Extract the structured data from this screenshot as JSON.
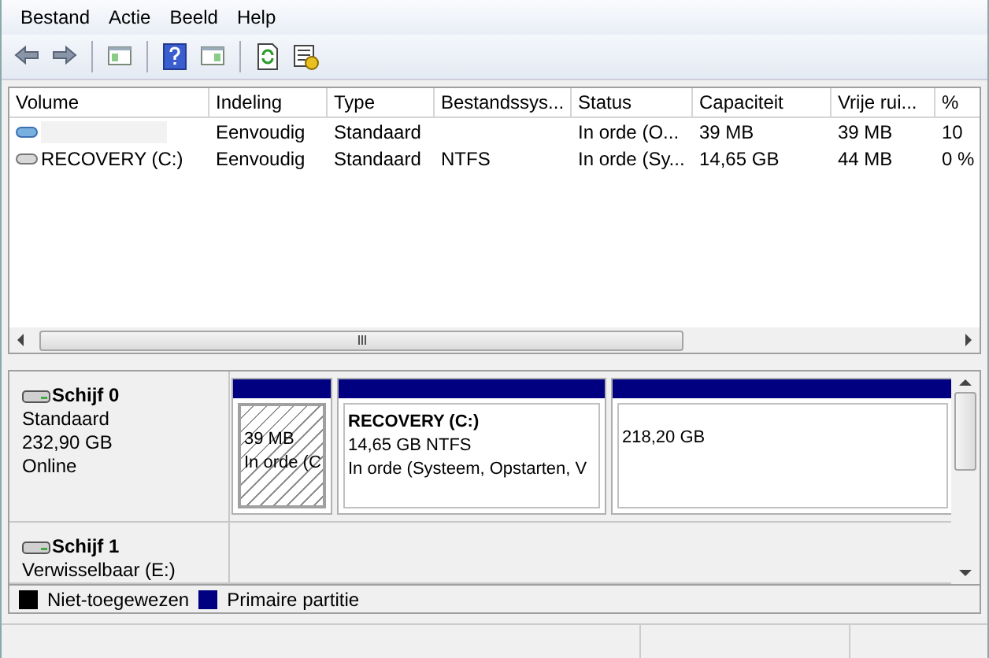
{
  "menu": [
    "Bestand",
    "Actie",
    "Beeld",
    "Help"
  ],
  "toolbar": [
    {
      "kind": "back",
      "disabled": false
    },
    {
      "kind": "forward",
      "disabled": false
    },
    {
      "kind": "sep"
    },
    {
      "kind": "pane",
      "disabled": false
    },
    {
      "kind": "sep"
    },
    {
      "kind": "help",
      "disabled": false
    },
    {
      "kind": "pane2",
      "disabled": false
    },
    {
      "kind": "sep"
    },
    {
      "kind": "refresh",
      "disabled": false
    },
    {
      "kind": "properties",
      "disabled": false
    }
  ],
  "volumes": {
    "columns": [
      "Volume",
      "Indeling",
      "Type",
      "Bestandssys...",
      "Status",
      "Capaciteit",
      "Vrije rui...",
      "%"
    ],
    "rows": [
      {
        "kind": "blue",
        "cells": [
          null,
          "Eenvoudig",
          "Standaard",
          null,
          "In orde (O...",
          "39 MB",
          "39 MB",
          "10"
        ]
      },
      {
        "kind": "grey",
        "cells": [
          "RECOVERY (C:)",
          "Eenvoudig",
          "Standaard",
          "NTFS",
          "In orde (Sy...",
          "14,65 GB",
          "44 MB",
          "0 %"
        ]
      }
    ]
  },
  "disks": [
    {
      "name": "Schijf 0",
      "lines": [
        "Standaard",
        "232,90 GB",
        "Online"
      ],
      "partitions": [
        {
          "color": "#000080",
          "selected": true,
          "lines": [
            "39 MB",
            "In orde (C"
          ]
        },
        {
          "color": "#000080",
          "selected": false,
          "title": "RECOVERY  (C:)",
          "lines": [
            "14,65 GB NTFS",
            "In orde (Systeem, Opstarten, V"
          ]
        },
        {
          "color": "#000080",
          "selected": false,
          "lines": [
            "218,20 GB"
          ]
        }
      ]
    },
    {
      "name": "Schijf 1",
      "lines": [
        "Verwisselbaar (E:)"
      ]
    }
  ],
  "legend": [
    {
      "label": "Niet-toegewezen",
      "color": "#000000"
    },
    {
      "label": "Primaire partitie",
      "color": "#000080"
    }
  ]
}
